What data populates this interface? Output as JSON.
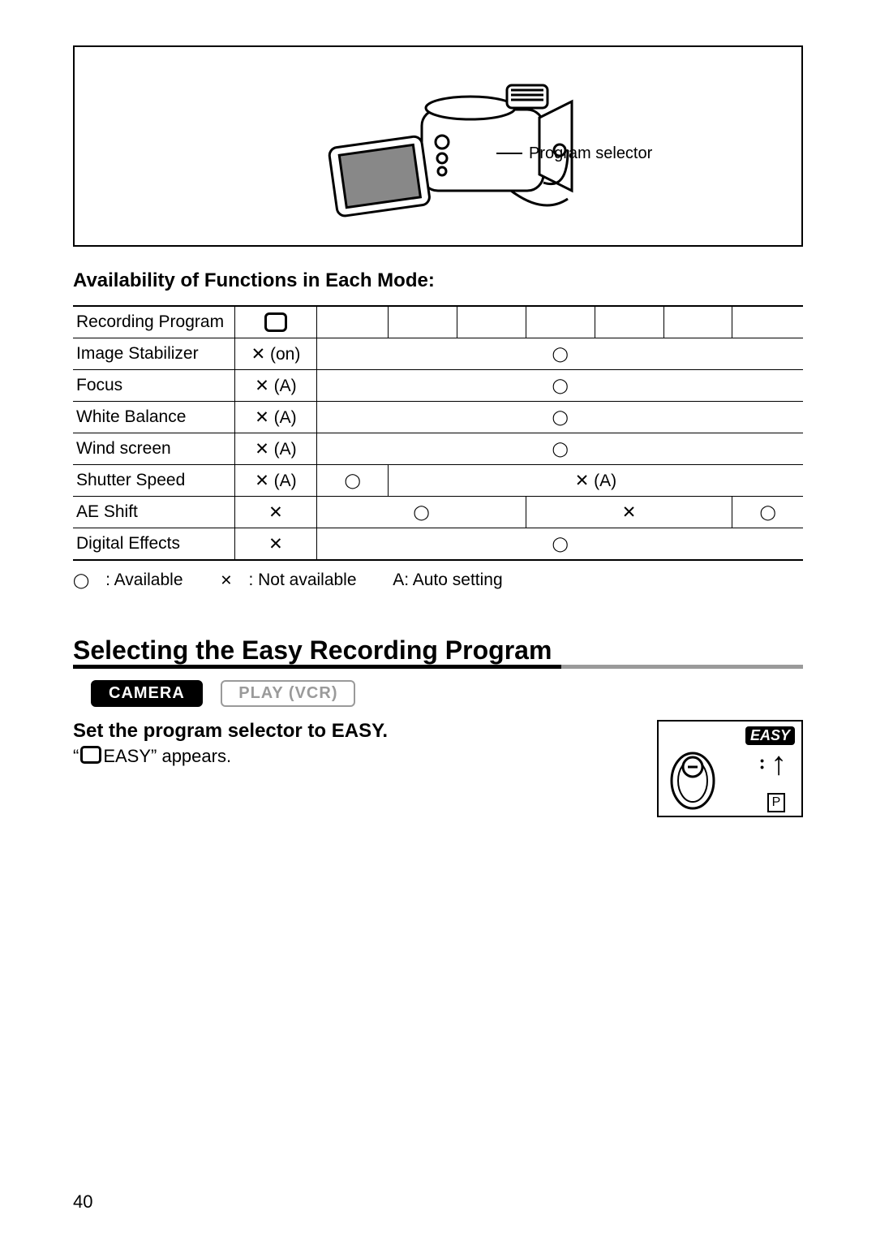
{
  "figure": {
    "label": "Program selector"
  },
  "table": {
    "heading": "Availability of Functions in Each Mode:",
    "rows": [
      {
        "label": "Recording Program",
        "col1_type": "rect",
        "col1": "",
        "col_rest_type": "blank",
        "col_rest": "",
        "cols": [
          {
            "t": "rect",
            "v": "",
            "span": 1
          },
          {
            "t": "empty",
            "v": "",
            "span": 1
          },
          {
            "t": "empty",
            "v": "",
            "span": 1
          },
          {
            "t": "empty",
            "v": "",
            "span": 1
          },
          {
            "t": "empty",
            "v": "",
            "span": 1
          },
          {
            "t": "empty",
            "v": "",
            "span": 1
          },
          {
            "t": "empty",
            "v": "",
            "span": 1
          },
          {
            "t": "empty",
            "v": "",
            "span": 1
          }
        ]
      },
      {
        "label": "Image Stabilizer"
      },
      {
        "label": "Focus"
      },
      {
        "label": "White Balance"
      },
      {
        "label": "Wind screen"
      },
      {
        "label": "Shutter Speed"
      },
      {
        "label": "AE Shift"
      },
      {
        "label": "Digital Effects"
      }
    ],
    "cells": {
      "image_stabilizer_c1": "✕ (on)",
      "focus_c1": "✕ (A)",
      "white_balance_c1": "✕ (A)",
      "wind_screen_c1": "✕ (A)",
      "shutter_speed_c1": "✕ (A)",
      "shutter_speed_rest": "✕ (A)",
      "ae_shift_c1": "✕",
      "ae_shift_c4": "✕",
      "digital_effects_c1": "✕"
    },
    "legend": {
      "available": ": Available",
      "not_available": ": Not available",
      "auto": "A: Auto setting"
    }
  },
  "section": {
    "heading": "Selecting the Easy Recording Program"
  },
  "modes": {
    "camera": "CAMERA",
    "play": "PLAY (VCR)"
  },
  "instruction": {
    "step": "Set the program selector to EASY.",
    "note_prefix": "“",
    "note_suffix": "EASY” appears."
  },
  "easy_box": {
    "badge": "EASY",
    "p": "P"
  },
  "page_number": "40"
}
